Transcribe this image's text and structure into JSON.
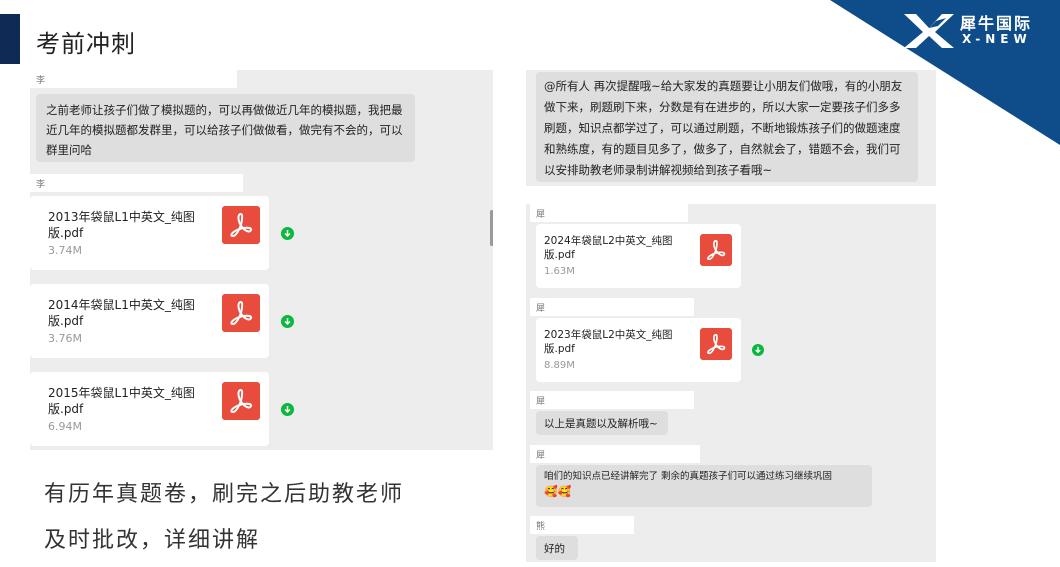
{
  "slide": {
    "title": "考前冲刺"
  },
  "brand": {
    "name_cn": "犀牛国际",
    "name_en": "X-NEW",
    "accent": "#0f4c8a",
    "title_bar": "#0f2a55"
  },
  "chat_left": {
    "messages": [
      {
        "sender": "李",
        "text": "之前老师让孩子们做了模拟题的，可以再做做近几年的模拟题，我把最近几年的模拟题都发群里，可以给孩子们做做看，做完有不会的，可以群里问哈"
      },
      {
        "sender": "李"
      }
    ],
    "files": [
      {
        "name": "2013年袋鼠L1中英文_纯图版.pdf",
        "size": "3.74M"
      },
      {
        "name": "2014年袋鼠L1中英文_纯图版.pdf",
        "size": "3.76M"
      },
      {
        "name": "2015年袋鼠L1中英文_纯图版.pdf",
        "size": "6.94M"
      }
    ]
  },
  "chat_right_top": {
    "text": "@所有人  再次提醒哦~给大家发的真题要让小朋友们做哦，有的小朋友做下来，刷题刷下来，分数是有在进步的，所以大家一定要孩子们多多刷题，知识点都学过了，可以通过刷题，不断地锻炼孩子们的做题速度和熟练度，有的题目见多了，做多了，自然就会了，错题不会，我们可以安排助教老师录制讲解视频给到孩子看哦~"
  },
  "chat_right": {
    "files": [
      {
        "sender": "犀",
        "name": "2024年袋鼠L2中英文_纯图版.pdf",
        "size": "1.63M"
      },
      {
        "sender": "犀",
        "name": "2023年袋鼠L2中英文_纯图版.pdf",
        "size": "8.89M"
      }
    ],
    "messages": [
      {
        "sender": "犀",
        "text": "以上是真题以及解析哦~"
      },
      {
        "sender": "犀",
        "text": "咱们的知识点已经讲解完了 剩余的真题孩子们可以通过练习继续巩固"
      },
      {
        "sender": "熊",
        "text": "好的"
      }
    ],
    "emoji": "🥰🥰"
  },
  "annotation": {
    "line1": "有历年真题卷，刷完之后助教老师",
    "line2": "及时批改，详细讲解"
  }
}
